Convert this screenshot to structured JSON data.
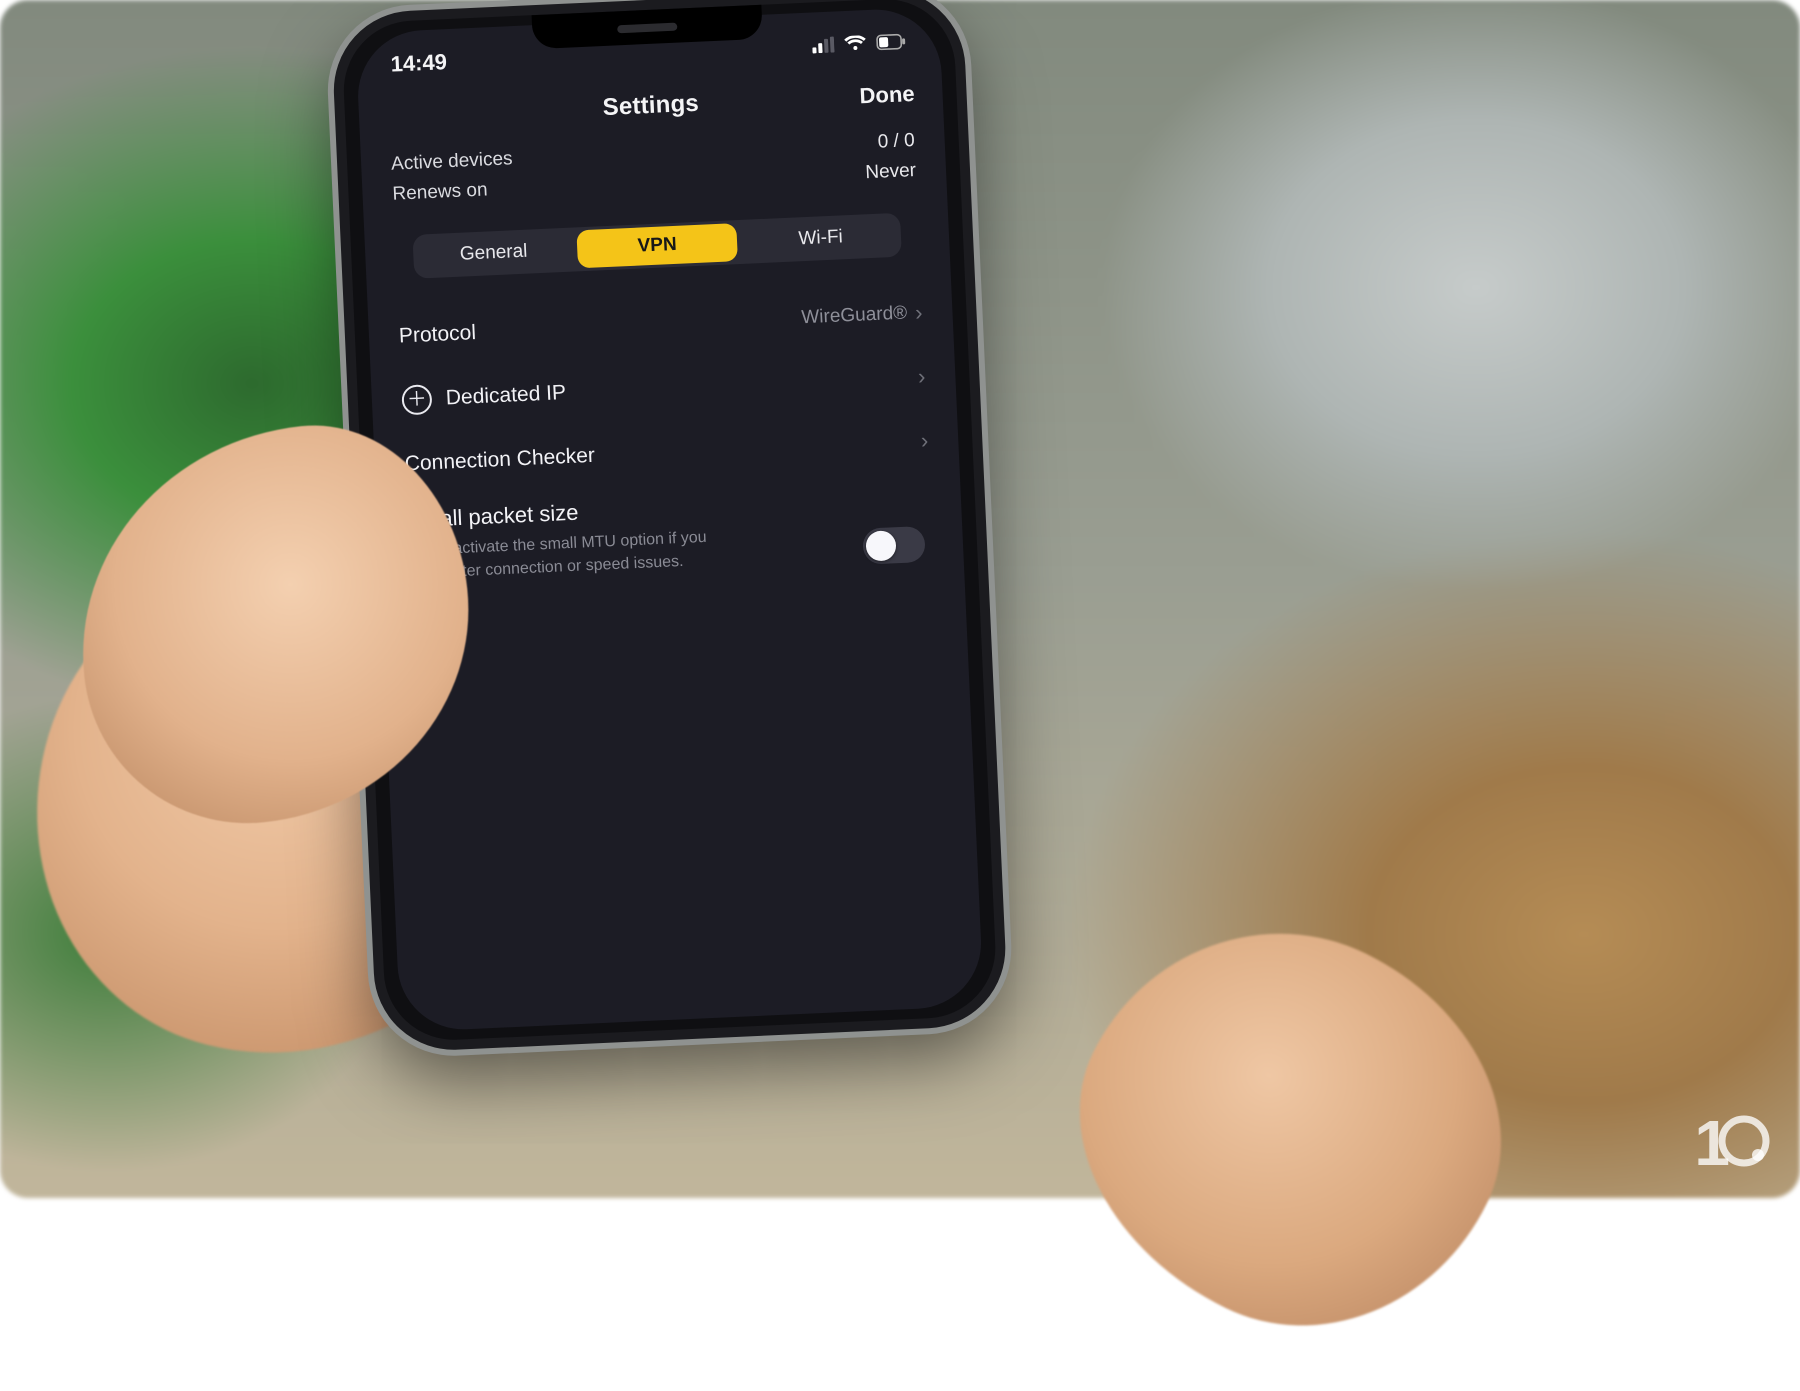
{
  "status": {
    "time": "14:49"
  },
  "header": {
    "title": "Settings",
    "done": "Done"
  },
  "info": {
    "activeDevicesLabel": "Active devices",
    "activeDevicesValue": "0 / 0",
    "renewsLabel": "Renews on",
    "renewsValue": "Never"
  },
  "tabs": {
    "general": "General",
    "vpn": "VPN",
    "wifi": "Wi-Fi",
    "active": "vpn"
  },
  "rows": {
    "protocolLabel": "Protocol",
    "protocolValue": "WireGuard®",
    "dedicatedIp": "Dedicated IP",
    "connectionChecker": "Connection Checker"
  },
  "smallPacket": {
    "title": "Small packet size",
    "desc": "Try to activate the small MTU option if you encounter connection or speed issues.",
    "enabled": false
  },
  "watermark": {
    "digit": "1"
  }
}
